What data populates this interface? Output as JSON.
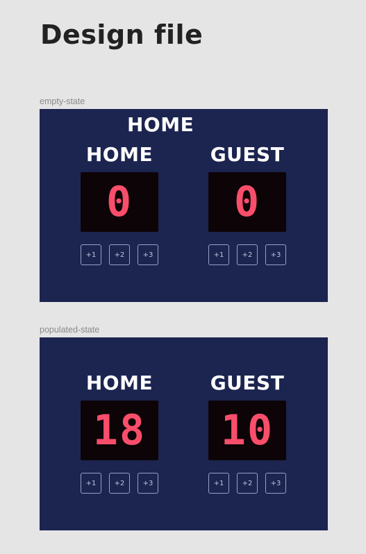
{
  "page": {
    "title": "Design file"
  },
  "frames": [
    {
      "label": "empty-state",
      "stray_label": "HOME",
      "home": {
        "name": "HOME",
        "score": "0",
        "buttons": [
          "+1",
          "+2",
          "+3"
        ]
      },
      "guest": {
        "name": "GUEST",
        "score": "0",
        "buttons": [
          "+1",
          "+2",
          "+3"
        ]
      }
    },
    {
      "label": "populated-state",
      "home": {
        "name": "HOME",
        "score": "18",
        "buttons": [
          "+1",
          "+2",
          "+3"
        ]
      },
      "guest": {
        "name": "GUEST",
        "score": "10",
        "buttons": [
          "+1",
          "+2",
          "+3"
        ]
      }
    }
  ],
  "colors": {
    "background": "#e5e5e5",
    "board": "#1c2450",
    "display": "#0d0407",
    "digits": "#f94e6b"
  }
}
